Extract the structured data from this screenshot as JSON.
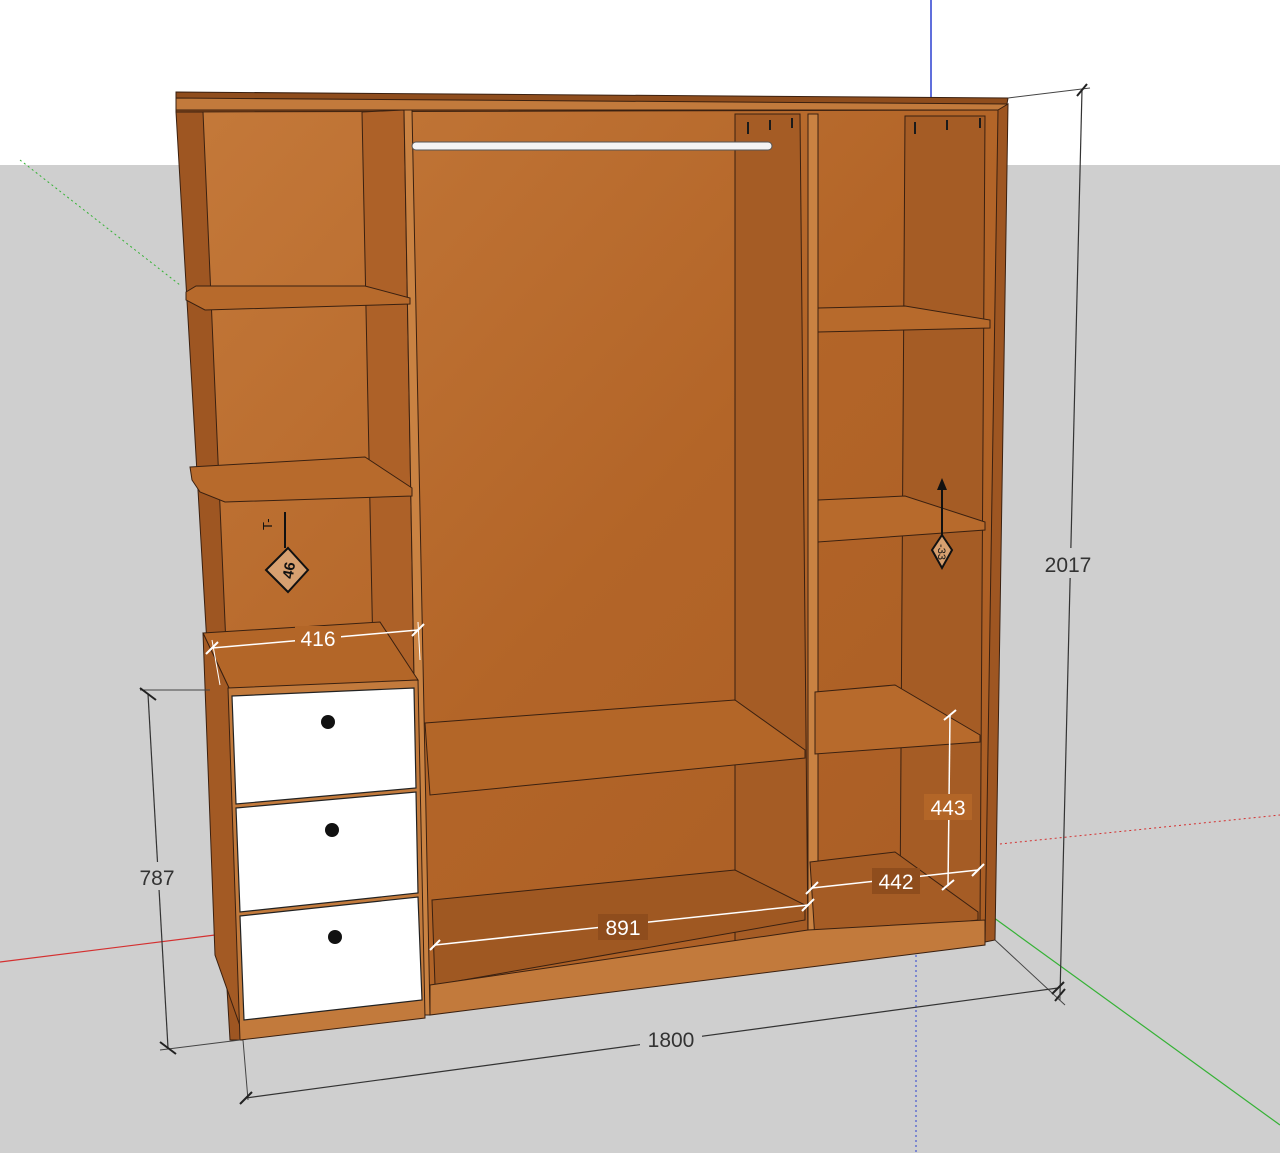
{
  "scene": {
    "sky_color": "#ffffff",
    "ground_color": "#cfcfcf",
    "wood_color": "#b86a2c",
    "wood_dark": "#8a4a1c",
    "drawer_color": "#ffffff",
    "axis_colors": {
      "red": "#d43030",
      "green": "#36b236",
      "blue": "#2a3fd0"
    }
  },
  "dimensions": {
    "total_height": "2017",
    "total_width": "1800",
    "drawer_unit_height": "787",
    "drawer_unit_width": "416",
    "middle_bay_width": "891",
    "right_bay_width": "442",
    "right_bay_height": "443"
  },
  "markers": {
    "left_tag_number": "46",
    "left_tag_text": "T-",
    "right_tag_text": "-33"
  }
}
